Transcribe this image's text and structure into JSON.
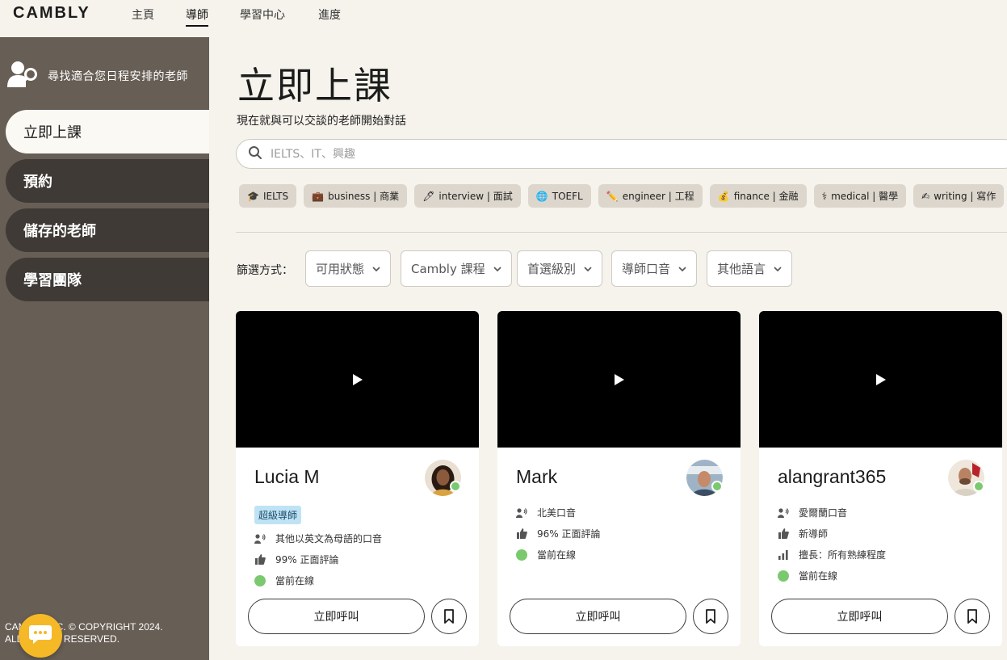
{
  "brand": "CAMBLY",
  "nav": [
    {
      "label": "主頁",
      "active": false
    },
    {
      "label": "導師",
      "active": true
    },
    {
      "label": "學習中心",
      "active": false
    },
    {
      "label": "進度",
      "active": false
    }
  ],
  "sidebar": {
    "header_icon": "user-search-icon",
    "header_text": "尋找適合您日程安排的老師",
    "items": [
      {
        "label": "立即上課",
        "active": true
      },
      {
        "label": "預約",
        "active": false
      },
      {
        "label": "儲存的老師",
        "active": false
      },
      {
        "label": "學習團隊",
        "active": false
      }
    ],
    "copyright_line1": "CAMBLY INC. © COPYRIGHT 2024.",
    "copyright_line2": "ALL RIGHTS RESERVED."
  },
  "main": {
    "title": "立即上課",
    "subtitle": "現在就與可以交談的老師開始對話",
    "search_placeholder": "IELTS、IT、興趣",
    "chips": [
      {
        "icon": "🎓",
        "label": "IELTS"
      },
      {
        "icon": "💼",
        "label": "business | 商業"
      },
      {
        "icon": "🖊",
        "label": "interview | 面試"
      },
      {
        "icon": "🌐",
        "label": "TOEFL"
      },
      {
        "icon": "✏️",
        "label": "engineer | 工程"
      },
      {
        "icon": "💰",
        "label": "finance | 金融"
      },
      {
        "icon": "⚕",
        "label": "medical | 醫學"
      },
      {
        "icon": "✍",
        "label": "writing | 寫作"
      },
      {
        "icon": "🎨",
        "label": ""
      }
    ],
    "filter_label": "篩選方式：",
    "filters": [
      "可用狀態",
      "Cambly 課程",
      "首選級別",
      "導師口音",
      "其他語言"
    ]
  },
  "tutors": [
    {
      "name": "Lucia M",
      "badge": "超級導師",
      "accent": "其他以英文為母語的口音",
      "rating": "99% 正面評論",
      "status": "當前在線",
      "call_label": "立即呼叫",
      "avatar_bg": "#8a5a3c"
    },
    {
      "name": "Mark",
      "accent": "北美口音",
      "rating": "96% 正面評論",
      "status": "當前在線",
      "call_label": "立即呼叫",
      "avatar_bg": "#6b7f94"
    },
    {
      "name": "alangrant365",
      "accent": "愛爾蘭口音",
      "rating": "新導師",
      "specialty": "擅長：所有熟練程度",
      "status": "當前在線",
      "call_label": "立即呼叫",
      "avatar_bg": "#9a6a55"
    }
  ],
  "colors": {
    "sidebar_bg": "#675e55",
    "sidebar_item": "#3f3a35",
    "page_bg": "#f6f3ec",
    "chip_bg": "#dcd6cc",
    "online": "#7bc96f",
    "badge_bg": "#bfe3f5",
    "chat": "#f5b927"
  }
}
